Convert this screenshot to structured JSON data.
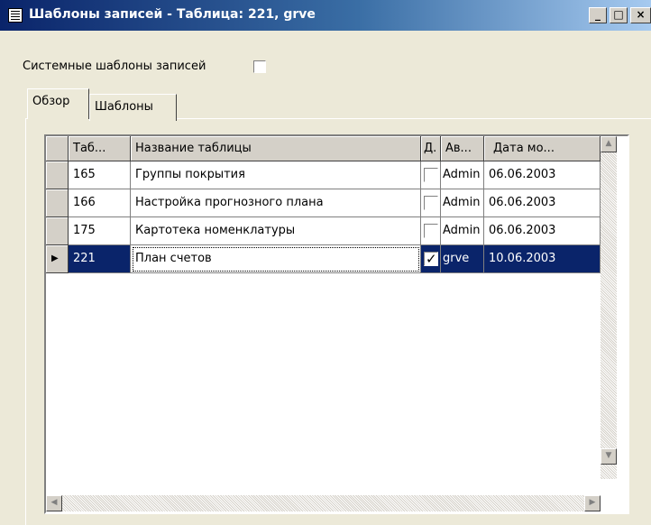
{
  "window": {
    "title": "Шаблоны записей - Таблица: 221, grve"
  },
  "controls": {
    "minimize": "_",
    "maximize": "□",
    "close": "×"
  },
  "system_templates": {
    "label": "Системные шаблоны записей",
    "checked": false
  },
  "tabs": [
    {
      "label": "Обзор",
      "active": true
    },
    {
      "label": "Шаблоны",
      "active": false
    }
  ],
  "grid": {
    "columns": [
      "Таб...",
      "Название таблицы",
      "Д.",
      "Ав...",
      "Дата мо..."
    ],
    "rows": [
      {
        "id": "165",
        "name": "Группы покрытия",
        "checked": false,
        "author": "Admin",
        "date": "06.06.2003",
        "selected": false
      },
      {
        "id": "166",
        "name": "Настройка прогнозного плана",
        "checked": false,
        "author": "Admin",
        "date": "06.06.2003",
        "selected": false
      },
      {
        "id": "175",
        "name": "Картотека номенклатуры",
        "checked": false,
        "author": "Admin",
        "date": "06.06.2003",
        "selected": false
      },
      {
        "id": "221",
        "name": "План счетов",
        "checked": true,
        "author": "grve",
        "date": "10.06.2003",
        "selected": true
      }
    ]
  },
  "colors": {
    "title_start": "#0a246a",
    "title_end": "#a6caf0",
    "selection": "#0a246a",
    "face": "#ece9d8"
  }
}
